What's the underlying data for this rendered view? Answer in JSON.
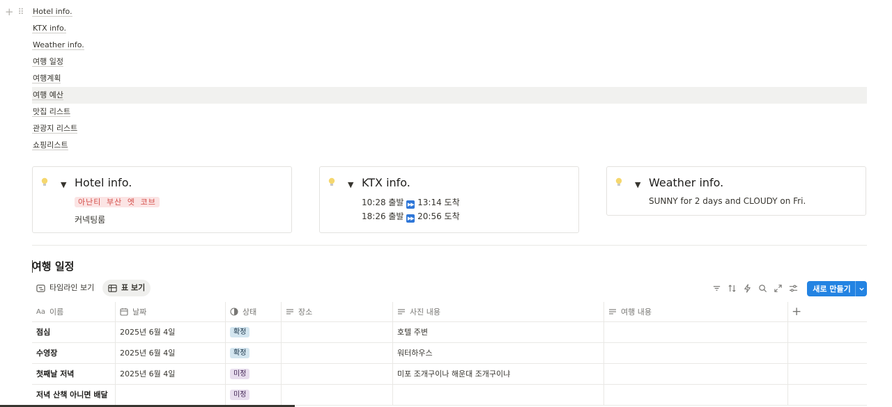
{
  "toc": [
    "Hotel info.",
    "KTX info.",
    "Weather info.",
    "여행 일정",
    "여행계획",
    "여행 예산",
    "맛집 리스트",
    "관광지 리스트",
    "쇼핑리스트"
  ],
  "callouts": {
    "hotel": {
      "title": "Hotel info.",
      "badge": "아난티 부산 엣 코브",
      "line2": "커넥팅룸"
    },
    "ktx": {
      "title": "KTX info.",
      "line1a": "10:28 출발",
      "line1b": "13:14 도착",
      "line2a": "18:26 출발",
      "line2b": "20:56 도착"
    },
    "weather": {
      "title": "Weather info.",
      "line1": "SUNNY for 2 days and CLOUDY on Fri."
    }
  },
  "section": {
    "title": "여행 일정"
  },
  "views": {
    "timeline": "타임라인 보기",
    "table": "표 보기"
  },
  "toolbar": {
    "new_label": "새로 만들기"
  },
  "table": {
    "headers": {
      "name": "이름",
      "date": "날짜",
      "status": "상태",
      "place": "장소",
      "photo": "사진 내용",
      "trip": "여행 내용"
    },
    "rows": [
      {
        "name": "점심",
        "date": "2025년 6월 4일",
        "status": "확정",
        "place": "",
        "photo": "호텔 주변",
        "trip": ""
      },
      {
        "name": "수영장",
        "date": "2025년 6월 4일",
        "status": "확정",
        "place": "",
        "photo": "워터하우스",
        "trip": ""
      },
      {
        "name": "첫째날 저녁",
        "date": "2025년 6월 4일",
        "status": "미정",
        "place": "",
        "photo": "미포 조개구이나 해운대 조개구이냐",
        "trip": ""
      },
      {
        "name": "저녁 산책 아니면 배달",
        "date": "",
        "status": "미정",
        "place": "",
        "photo": "",
        "trip": ""
      }
    ]
  },
  "colors": {
    "accent": "#2383e2",
    "confirmed": "#d3e5ef",
    "pending": "#e8deee",
    "badge": "#fbe4e4"
  }
}
